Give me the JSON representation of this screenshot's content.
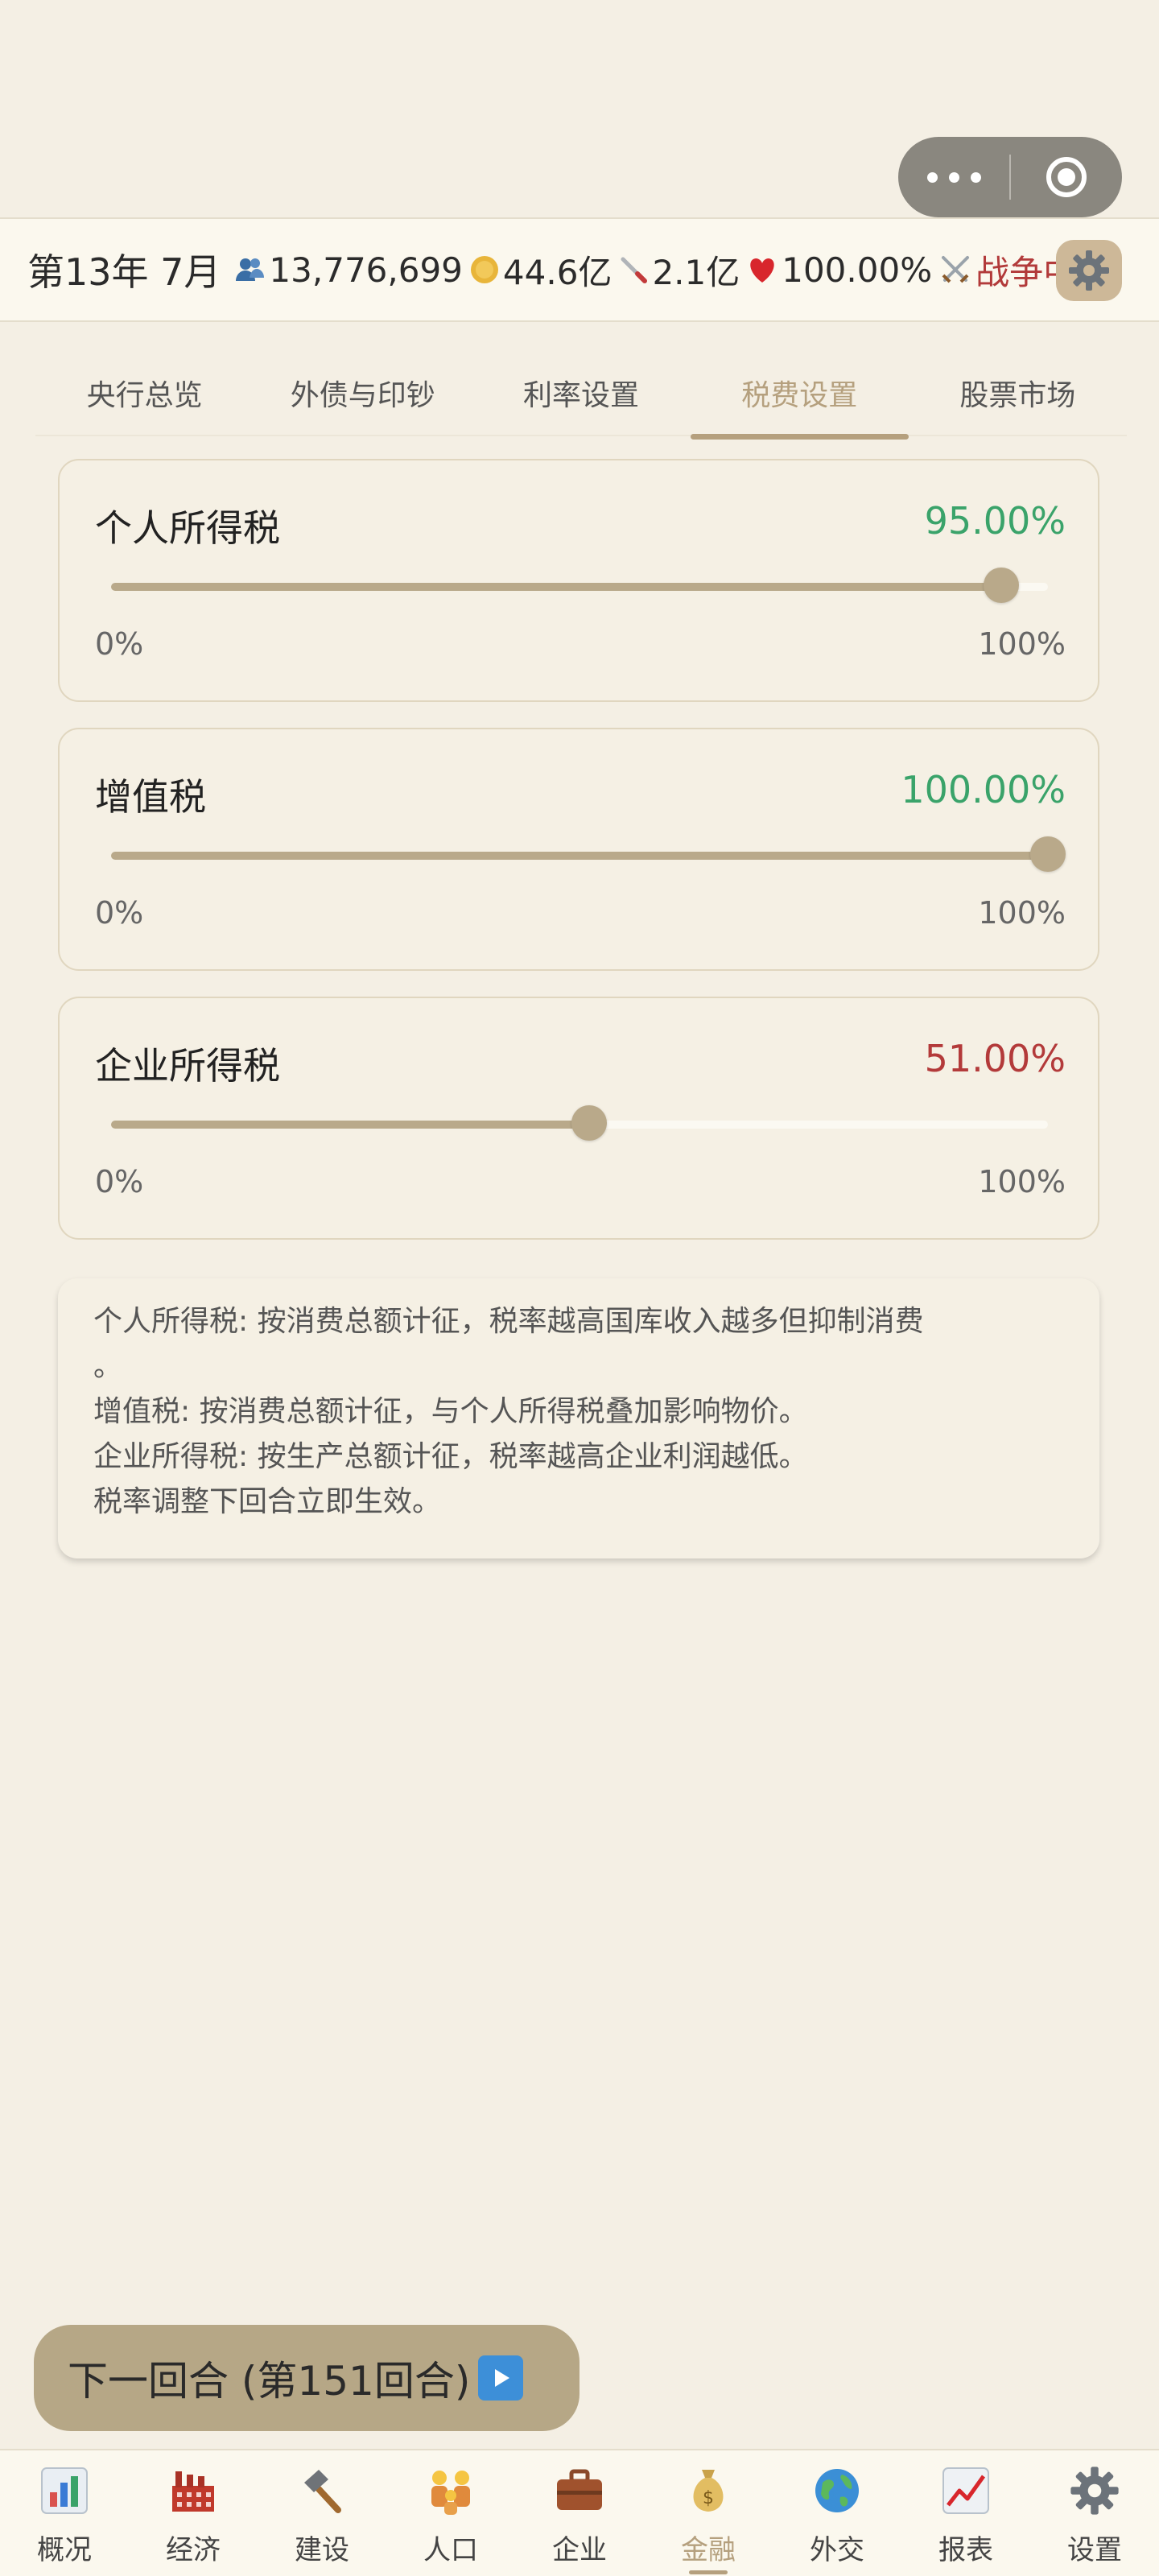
{
  "status": {
    "date": "第13年 7月",
    "population": "13,776,699",
    "treasury": "44.6亿",
    "military": "2.1亿",
    "approval": "100.00%",
    "war_status": "战争中"
  },
  "tabs": [
    {
      "label": "央行总览",
      "active": false
    },
    {
      "label": "外债与印钞",
      "active": false
    },
    {
      "label": "利率设置",
      "active": false
    },
    {
      "label": "税费设置",
      "active": true
    },
    {
      "label": "股票市场",
      "active": false
    }
  ],
  "taxes": [
    {
      "name": "个人所得税",
      "value_text": "95.00%",
      "value": 0.95,
      "min_label": "0%",
      "max_label": "100%",
      "color": "#3aa36a"
    },
    {
      "name": "增值税",
      "value_text": "100.00%",
      "value": 1.0,
      "min_label": "0%",
      "max_label": "100%",
      "color": "#3aa36a"
    },
    {
      "name": "企业所得税",
      "value_text": "51.00%",
      "value": 0.51,
      "min_label": "0%",
      "max_label": "100%",
      "color": "#b33a3a"
    }
  ],
  "info": {
    "line1": "个人所得税: 按消费总额计征，税率越高国库收入越多但抑制消费",
    "line1b": "。",
    "line2": "增值税: 按消费总额计征，与个人所得税叠加影响物价。",
    "line3": "企业所得税: 按生产总额计征，税率越高企业利润越低。",
    "line4": "税率调整下回合立即生效。"
  },
  "next_round": {
    "label": "下一回合 (第151回合)"
  },
  "nav": [
    {
      "label": "概况",
      "icon": "chart-icon",
      "active": false
    },
    {
      "label": "经济",
      "icon": "factory-icon",
      "active": false
    },
    {
      "label": "建设",
      "icon": "hammer-icon",
      "active": false
    },
    {
      "label": "人口",
      "icon": "family-icon",
      "active": false
    },
    {
      "label": "企业",
      "icon": "briefcase-icon",
      "active": false
    },
    {
      "label": "金融",
      "icon": "money-bag-icon",
      "active": true
    },
    {
      "label": "外交",
      "icon": "globe-icon",
      "active": false
    },
    {
      "label": "报表",
      "icon": "report-icon",
      "active": false
    },
    {
      "label": "设置",
      "icon": "gear-icon",
      "active": false
    }
  ],
  "colors": {
    "accent": "#b5a07e",
    "background": "#f4efe4",
    "slider": "#b9a98a",
    "positive": "#3aa36a",
    "negative": "#b33a3a"
  }
}
